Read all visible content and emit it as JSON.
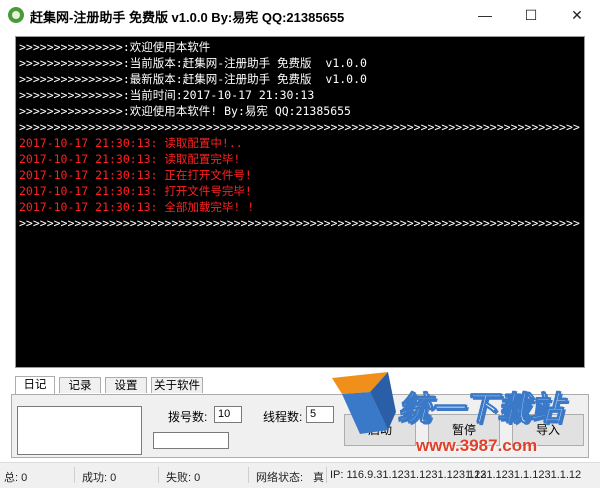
{
  "window": {
    "title": "赶集网-注册助手 免费版 v1.0.0 By:易宪 QQ:21385655",
    "minimize": "—",
    "maximize": "☐",
    "close": "✕"
  },
  "console": {
    "lines": [
      {
        "text": ">>>>>>>>>>>>>>>:欢迎使用本软件",
        "color": "#ffffff"
      },
      {
        "text": ">>>>>>>>>>>>>>>:当前版本:赶集网-注册助手 免费版  v1.0.0",
        "color": "#ffffff"
      },
      {
        "text": ">>>>>>>>>>>>>>>:最新版本:赶集网-注册助手 免费版  v1.0.0",
        "color": "#ffffff"
      },
      {
        "text": ">>>>>>>>>>>>>>>:当前时间:2017-10-17 21:30:13",
        "color": "#ffffff"
      },
      {
        "text": ">>>>>>>>>>>>>>>:欢迎使用本软件! By:易宪 QQ:21385655",
        "color": "#ffffff"
      },
      {
        "text": ">>>>>>>>>>>>>>>>>>>>>>>>>>>>>>>>>>>>>>>>>>>>>>>>>>>>>>>>>>>>>>>>>>>>>>>>>>>>>>>>>",
        "color": "#ffffff"
      },
      {
        "text": "2017-10-17 21:30:13: 读取配置中!..",
        "color": "#ff2020"
      },
      {
        "text": "2017-10-17 21:30:13: 读取配置完毕!",
        "color": "#ff2020"
      },
      {
        "text": "2017-10-17 21:30:13: 正在打开文件号!",
        "color": "#ff2020"
      },
      {
        "text": "2017-10-17 21:30:13: 打开文件号完毕!",
        "color": "#ff2020"
      },
      {
        "text": "2017-10-17 21:30:13: 全部加载完毕! !",
        "color": "#ff2020"
      },
      {
        "text": ">>>>>>>>>>>>>>>>>>>>>>>>>>>>>>>>>>>>>>>>>>>>>>>>>>>>>>>>>>>>>>>>>>>>>>>>>>>>>>>>>",
        "color": "#ffffff"
      }
    ]
  },
  "tabs": [
    "日记",
    "记录",
    "设置",
    "关于软件"
  ],
  "controls": {
    "dial_label": "拨号数:",
    "dial_value": "10",
    "thread_label": "线程数:",
    "thread_value": "5",
    "start_button": "启动",
    "pause_button": "暂停",
    "import_button": "导入"
  },
  "status": {
    "total": "总: 0",
    "success": "成功: 0",
    "fail": "失败: 0",
    "net_label": "网络状态:",
    "net_value": "真",
    "ip": "IP: 116.9.31.1231.1231.1231.12",
    "ip2": "1231.1231.1.1231.1.12"
  },
  "watermark": {
    "brand": "统一下载站",
    "url": "www.3987.com"
  },
  "colors": {
    "console_bg": "#000000",
    "log_red": "#ff2020",
    "watermark_blue": "#3a78c8",
    "watermark_orange": "#f0901a"
  }
}
